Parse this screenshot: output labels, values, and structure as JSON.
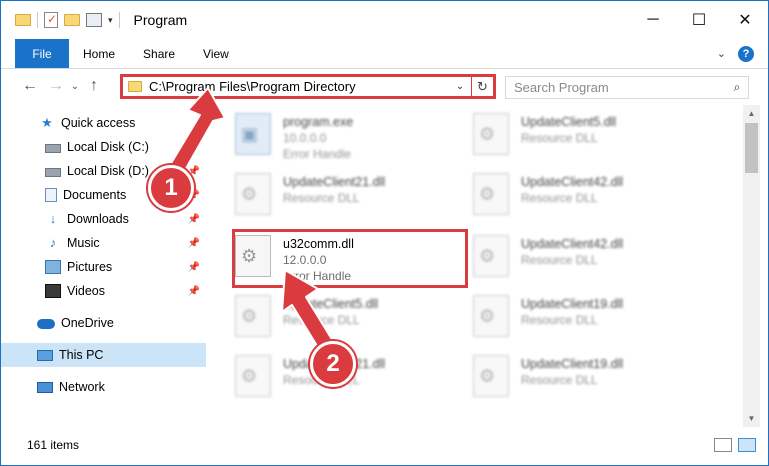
{
  "window": {
    "title": "Program"
  },
  "window_controls": {
    "minimize": "─",
    "maximize": "☐",
    "close": "✕"
  },
  "ribbon": {
    "tabs": [
      "File",
      "Home",
      "Share",
      "View"
    ]
  },
  "nav": {
    "address": "C:\\Program Files\\Program Directory",
    "search_placeholder": "Search Program"
  },
  "sidebar": {
    "items": [
      {
        "label": "Quick access",
        "icon": "quick-access-star-icon",
        "pinned": false
      },
      {
        "label": "Local Disk (C:)",
        "icon": "drive-icon",
        "pinned": true
      },
      {
        "label": "Local Disk (D:)",
        "icon": "drive-icon",
        "pinned": true
      },
      {
        "label": "Documents",
        "icon": "documents-icon",
        "pinned": true
      },
      {
        "label": "Downloads",
        "icon": "downloads-icon",
        "pinned": true
      },
      {
        "label": "Music",
        "icon": "music-icon",
        "pinned": true
      },
      {
        "label": "Pictures",
        "icon": "pictures-icon",
        "pinned": true
      },
      {
        "label": "Videos",
        "icon": "videos-icon",
        "pinned": true
      },
      {
        "label": "OneDrive",
        "icon": "onedrive-icon",
        "pinned": false
      },
      {
        "label": "This PC",
        "icon": "this-pc-icon",
        "pinned": false,
        "selected": true
      },
      {
        "label": "Network",
        "icon": "network-icon",
        "pinned": false
      }
    ]
  },
  "files": [
    {
      "name": "program.exe",
      "sub": "Error Handle",
      "size_line": "10.0.0.0",
      "kind": "exe",
      "blurred": true
    },
    {
      "name": "UpdateClient5.dll",
      "sub": "Resource DLL",
      "kind": "dll",
      "blurred": true
    },
    {
      "name": "UpdateClient21.dll",
      "sub": "Resource DLL",
      "kind": "dll",
      "blurred": true
    },
    {
      "name": "UpdateClient42.dll",
      "sub": "Resource DLL",
      "kind": "dll",
      "blurred": true
    },
    {
      "name": "u32comm.dll",
      "sub": "Error Handle",
      "size_line": "12.0.0.0",
      "kind": "dll",
      "blurred": false
    },
    {
      "name": "UpdateClient42.dll",
      "sub": "Resource DLL",
      "kind": "dll",
      "blurred": true
    },
    {
      "name": "UpdateClient5.dll",
      "sub": "Resource DLL",
      "kind": "dll",
      "blurred": true
    },
    {
      "name": "UpdateClient19.dll",
      "sub": "Resource DLL",
      "kind": "dll",
      "blurred": true
    },
    {
      "name": "UpdateClient21.dll",
      "sub": "Resource DLL",
      "kind": "dll",
      "blurred": true
    },
    {
      "name": "UpdateClient19.dll",
      "sub": "Resource DLL",
      "kind": "dll",
      "blurred": true
    }
  ],
  "status": {
    "item_count": "161 items"
  },
  "annotations": {
    "step1": "1",
    "step2": "2",
    "color": "#d93b3f"
  }
}
